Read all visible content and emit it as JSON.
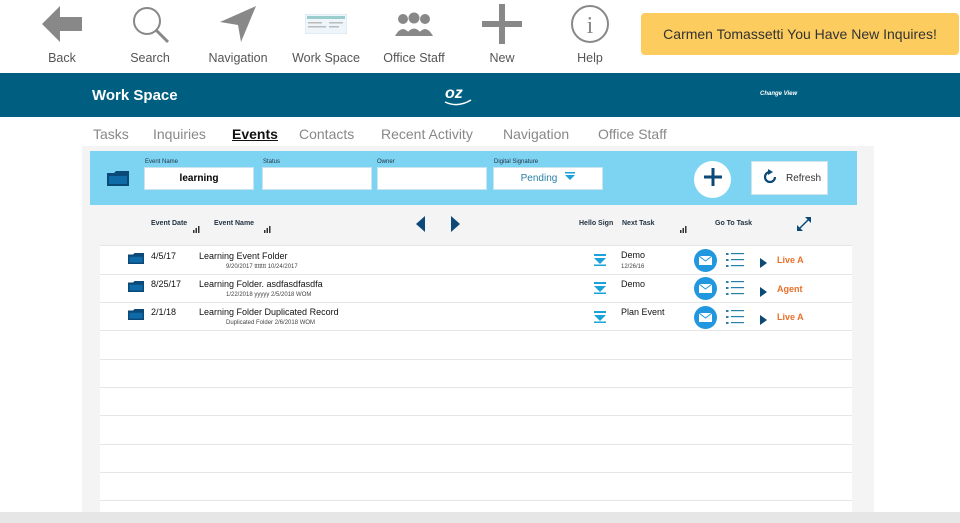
{
  "toolbar": {
    "items": [
      {
        "label": "Back",
        "icon": "back-arrow-icon"
      },
      {
        "label": "Search",
        "icon": "search-icon"
      },
      {
        "label": "Navigation",
        "icon": "navigation-arrow-icon"
      },
      {
        "label": "Work Space",
        "icon": "workspace-icon"
      },
      {
        "label": "Office Staff",
        "icon": "people-icon"
      },
      {
        "label": "New",
        "icon": "plus-icon"
      },
      {
        "label": "Help",
        "icon": "info-icon"
      }
    ],
    "notification": "Carmen Tomassetti You Have New Inquires!"
  },
  "header": {
    "title": "Work Space",
    "change_view": "Change View"
  },
  "tabs": [
    "Tasks",
    "Inquiries",
    "Events",
    "Contacts",
    "Recent Activity",
    "Navigation",
    "Office Staff"
  ],
  "filters": {
    "event_name_label": "Event Name",
    "event_name_value": "learning",
    "status_label": "Status",
    "status_value": "",
    "owner_label": "Owner",
    "owner_value": "",
    "digital_signature_label": "Digital Signature",
    "digital_signature_value": "Pending",
    "refresh_label": "Refresh"
  },
  "table": {
    "headers": {
      "event_date": "Event Date",
      "event_name": "Event Name",
      "hello_sign": "Hello Sign",
      "next_task": "Next Task",
      "go_to_task": "Go To Task"
    },
    "rows": [
      {
        "date": "4/5/17",
        "name": "Learning Event Folder",
        "sub": "9/20/2017 ttttttt  10/24/2017",
        "next_task": "Demo",
        "next_task_date": "12/26/16",
        "go_to": "Live A"
      },
      {
        "date": "8/25/17",
        "name": "Learning  Folder. asdfasdfasdfa",
        "sub": "1/22/2018 yyyyy  2/5/2018 WOM",
        "next_task": "Demo",
        "next_task_date": "",
        "go_to": "Agent"
      },
      {
        "date": "2/1/18",
        "name": "Learning  Folder Duplicated Record",
        "sub": "Duplicated Folder  2/6/2018 WOM",
        "next_task": "Plan Event",
        "next_task_date": "",
        "go_to": "Live A"
      }
    ]
  },
  "colors": {
    "header_bg": "#005f80",
    "filter_bg": "#7dd4f2",
    "notify_bg": "#fccc5e",
    "accent": "#e8702a",
    "mail": "#2197e0"
  }
}
